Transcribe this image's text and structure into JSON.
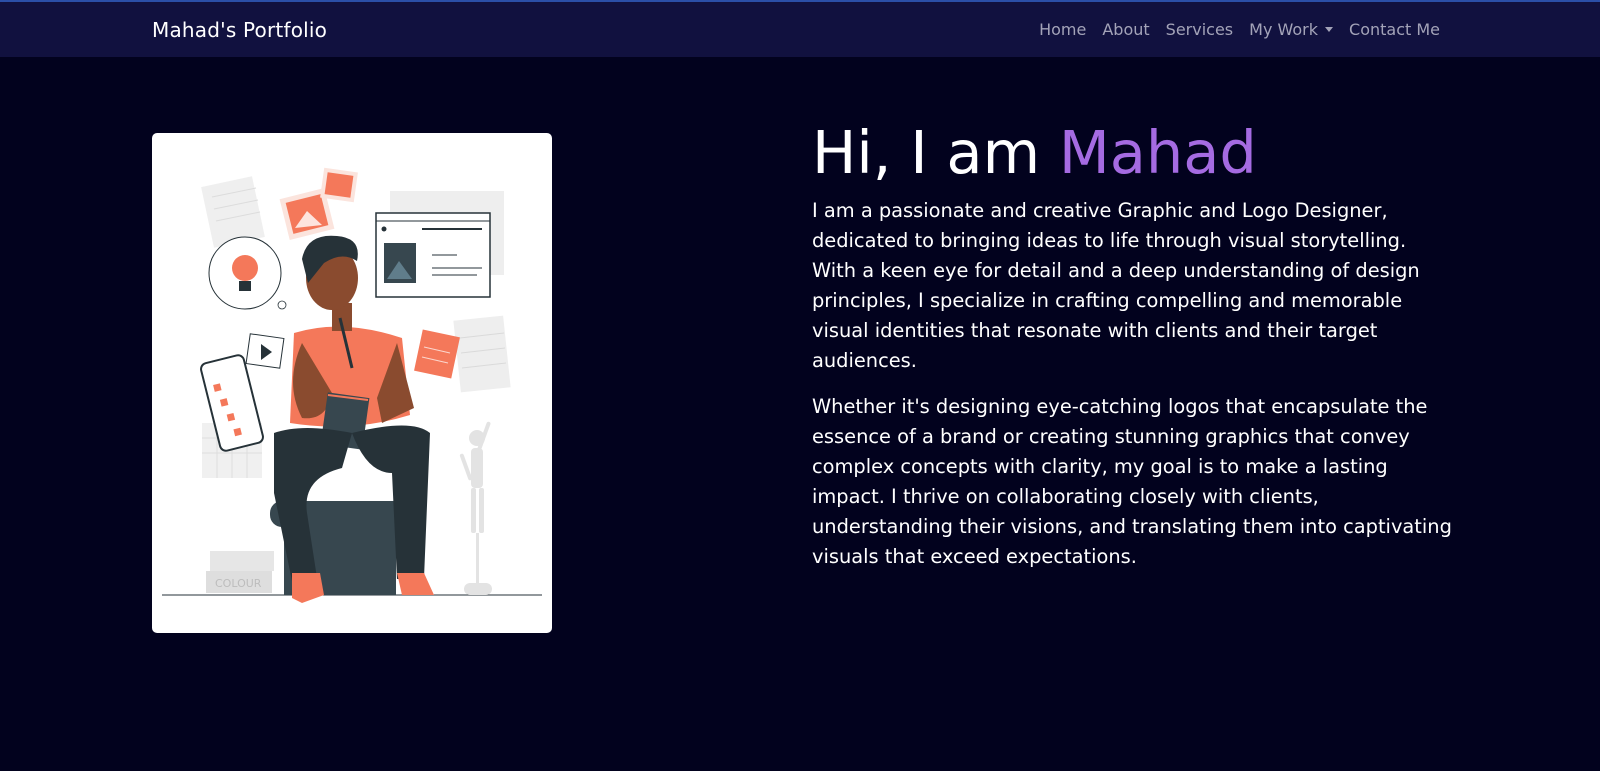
{
  "navbar": {
    "brand": "Mahad's Portfolio",
    "links": [
      {
        "label": "Home"
      },
      {
        "label": "About"
      },
      {
        "label": "Services"
      },
      {
        "label": "My Work",
        "dropdown": true
      },
      {
        "label": "Contact Me"
      }
    ]
  },
  "hero": {
    "greeting": "Hi, I am ",
    "name": "Mahad",
    "paragraphs": [
      "I am a passionate and creative Graphic and Logo Designer, dedicated to bringing ideas to life through visual storytelling. With a keen eye for detail and a deep understanding of design principles, I specialize in crafting compelling and memorable visual identities that resonate with clients and their target audiences.",
      "Whether it's designing eye-catching logos that encapsulate the essence of a brand or creating stunning graphics that convey complex concepts with clarity, my goal is to make a lasting impact. I thrive on collaborating closely with clients, understanding their visions, and translating them into captivating visuals that exceed expectations."
    ],
    "illustration_text": "COLOUR"
  },
  "colors": {
    "page_background": "#02021e",
    "navbar_background": "#11113f",
    "accent": "#a56be2",
    "nav_link": "#a3a3b8",
    "illustration_orange": "#f4785a",
    "illustration_dark": "#263238"
  }
}
